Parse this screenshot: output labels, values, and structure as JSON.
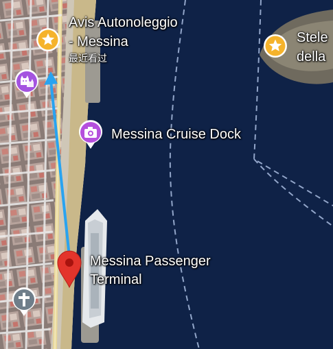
{
  "map": {
    "places": {
      "avis": {
        "name_line1": "Avis Autonoleggio",
        "name_line2": "- Messina",
        "subtitle": "最近看过",
        "icon": "star-icon",
        "color": "#f5b32c"
      },
      "stele": {
        "name_line1": "Stele",
        "name_line2": "della",
        "icon": "star-icon",
        "color": "#f5b32c"
      },
      "cruise_dock": {
        "name": "Messina Cruise Dock",
        "icon": "camera-icon",
        "color": "#b54fdd"
      },
      "passenger_terminal": {
        "name_line1": "Messina Passenger",
        "name_line2": "Terminal",
        "icon": "red-location-pin-icon",
        "color": "#e3342b"
      },
      "cat_place": {
        "icon": "cat-icon",
        "color": "#a453e0"
      },
      "church": {
        "icon": "cross-icon",
        "color": "#6f7e8a"
      }
    },
    "route": {
      "color": "#29a3f0"
    },
    "colors": {
      "sea": "#0f2247",
      "land": "#6b6563",
      "shore": "#c9b88a",
      "ferry_line": "#a9bde0"
    }
  }
}
